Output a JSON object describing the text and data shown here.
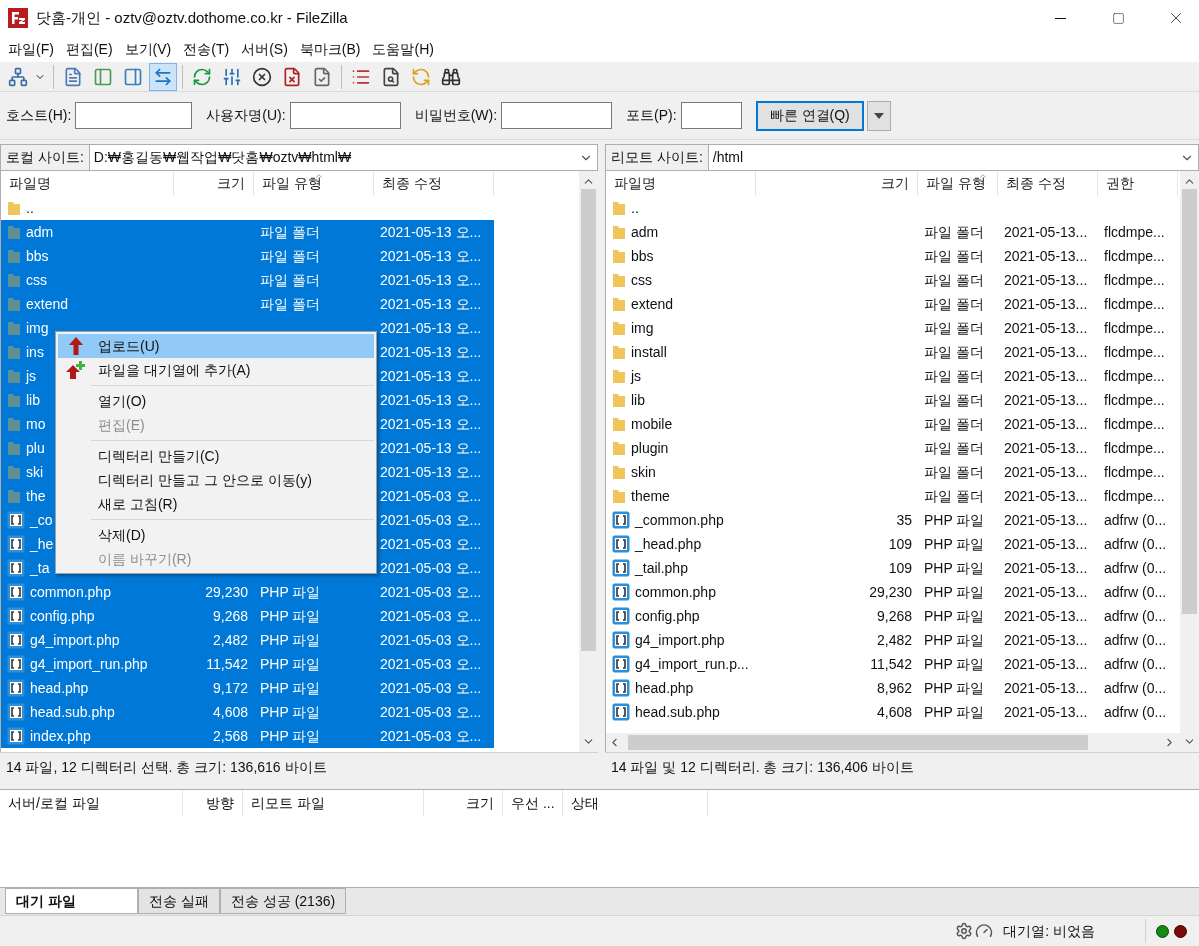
{
  "window": {
    "title": "닷홈-개인 - oztv@oztv.dothome.co.kr - FileZilla"
  },
  "menu": [
    "파일(F)",
    "편집(E)",
    "보기(V)",
    "전송(T)",
    "서버(S)",
    "북마크(B)",
    "도움말(H)"
  ],
  "toolbar": [
    {
      "on": false
    },
    {
      "on": false
    },
    {
      "on": false
    },
    {
      "on": false
    },
    {
      "on": true
    },
    {
      "on": false
    },
    {
      "on": false
    },
    {
      "on": false
    },
    {
      "on": false
    },
    {
      "on": false
    },
    {
      "on": false
    },
    {
      "on": false
    },
    {
      "on": false
    },
    {
      "on": false
    }
  ],
  "quickconnect": {
    "fields": [
      {
        "label": "호스트(H):"
      },
      {
        "label": "사용자명(U):"
      },
      {
        "label": "비밀번호(W):"
      },
      {
        "label": "포트(P):"
      }
    ],
    "button": "빠른 연결(Q)"
  },
  "local": {
    "site_label": "로컬 사이트:",
    "path": "D:₩홍길동₩웹작업₩닷홈₩oztv₩html₩",
    "columns": [
      {
        "label": "파일명",
        "sorted": false
      },
      {
        "label": "크기",
        "sorted": false
      },
      {
        "label": "파일 유형",
        "sorted": true
      },
      {
        "label": "최종 수정",
        "sorted": false
      }
    ],
    "rows": [
      {
        "kind": "parent",
        "name": "..",
        "selected": false
      },
      {
        "kind": "folder",
        "name": "adm",
        "type": "파일 폴더",
        "modified": "2021-05-13 오...",
        "selected": true
      },
      {
        "kind": "folder",
        "name": "bbs",
        "type": "파일 폴더",
        "modified": "2021-05-13 오...",
        "selected": true
      },
      {
        "kind": "folder",
        "name": "css",
        "type": "파일 폴더",
        "modified": "2021-05-13 오...",
        "selected": true
      },
      {
        "kind": "folder",
        "name": "extend",
        "type": "파일 폴더",
        "modified": "2021-05-13 오...",
        "selected": true
      },
      {
        "kind": "folder",
        "name": "img",
        "modified": "2021-05-13 오...",
        "selected": true
      },
      {
        "kind": "folder",
        "name": "ins",
        "modified": "2021-05-13 오...",
        "selected": true
      },
      {
        "kind": "folder",
        "name": "js",
        "modified": "2021-05-13 오...",
        "selected": true
      },
      {
        "kind": "folder",
        "name": "lib",
        "modified": "2021-05-13 오...",
        "selected": true
      },
      {
        "kind": "folder",
        "name": "mo",
        "modified": "2021-05-13 오...",
        "selected": true
      },
      {
        "kind": "folder",
        "name": "plu",
        "modified": "2021-05-13 오...",
        "selected": true
      },
      {
        "kind": "folder",
        "name": "ski",
        "modified": "2021-05-13 오...",
        "selected": true
      },
      {
        "kind": "folder",
        "name": "the",
        "modified": "2021-05-03 오...",
        "selected": true
      },
      {
        "kind": "file",
        "name": "_co",
        "modified": "2021-05-03 오...",
        "selected": true
      },
      {
        "kind": "file",
        "name": "_he",
        "modified": "2021-05-03 오...",
        "selected": true
      },
      {
        "kind": "file",
        "name": "_ta",
        "modified": "2021-05-03 오...",
        "selected": true
      },
      {
        "kind": "file",
        "name": "common.php",
        "size": "29,230",
        "type": "PHP 파일",
        "modified": "2021-05-03 오...",
        "selected": true
      },
      {
        "kind": "file",
        "name": "config.php",
        "size": "9,268",
        "type": "PHP 파일",
        "modified": "2021-05-03 오...",
        "selected": true
      },
      {
        "kind": "file",
        "name": "g4_import.php",
        "size": "2,482",
        "type": "PHP 파일",
        "modified": "2021-05-03 오...",
        "selected": true
      },
      {
        "kind": "file",
        "name": "g4_import_run.php",
        "size": "11,542",
        "type": "PHP 파일",
        "modified": "2021-05-03 오...",
        "selected": true
      },
      {
        "kind": "file",
        "name": "head.php",
        "size": "9,172",
        "type": "PHP 파일",
        "modified": "2021-05-03 오...",
        "selected": true
      },
      {
        "kind": "file",
        "name": "head.sub.php",
        "size": "4,608",
        "type": "PHP 파일",
        "modified": "2021-05-03 오...",
        "selected": true
      },
      {
        "kind": "file",
        "name": "index.php",
        "size": "2,568",
        "type": "PHP 파일",
        "modified": "2021-05-03 오...",
        "selected": true
      }
    ],
    "status": "14 파일, 12 디렉터리 선택. 총 크기: 136,616 바이트"
  },
  "context_menu": [
    {
      "kind": "item",
      "label": "업로드(U)",
      "selected": true,
      "disabled": false
    },
    {
      "kind": "item",
      "label": "파일을 대기열에 추가(A)",
      "selected": false,
      "disabled": false
    },
    {
      "kind": "separator"
    },
    {
      "kind": "item",
      "label": "열기(O)",
      "selected": false,
      "disabled": false
    },
    {
      "kind": "item",
      "label": "편집(E)",
      "selected": false,
      "disabled": true
    },
    {
      "kind": "separator"
    },
    {
      "kind": "item",
      "label": "디렉터리 만들기(C)",
      "selected": false,
      "disabled": false
    },
    {
      "kind": "item",
      "label": "디렉터리 만들고 그 안으로 이동(y)",
      "selected": false,
      "disabled": false
    },
    {
      "kind": "item",
      "label": "새로 고침(R)",
      "selected": false,
      "disabled": false
    },
    {
      "kind": "separator"
    },
    {
      "kind": "item",
      "label": "삭제(D)",
      "selected": false,
      "disabled": false
    },
    {
      "kind": "item",
      "label": "이름 바꾸기(R)",
      "selected": false,
      "disabled": true
    }
  ],
  "remote": {
    "site_label": "리모트 사이트:",
    "path": "/html",
    "columns": [
      {
        "label": "파일명",
        "sorted": false
      },
      {
        "label": "크기",
        "sorted": false
      },
      {
        "label": "파일 유형",
        "sorted": true
      },
      {
        "label": "최종 수정",
        "sorted": false
      },
      {
        "label": "권한",
        "sorted": false
      }
    ],
    "rows": [
      {
        "kind": "parent",
        "name": "..",
        "selected": false
      },
      {
        "kind": "folder",
        "name": "adm",
        "type": "파일 폴더",
        "modified": "2021-05-13...",
        "permissions": "flcdmpe...",
        "selected": false
      },
      {
        "kind": "folder",
        "name": "bbs",
        "type": "파일 폴더",
        "modified": "2021-05-13...",
        "permissions": "flcdmpe...",
        "selected": false
      },
      {
        "kind": "folder",
        "name": "css",
        "type": "파일 폴더",
        "modified": "2021-05-13...",
        "permissions": "flcdmpe...",
        "selected": false
      },
      {
        "kind": "folder",
        "name": "extend",
        "type": "파일 폴더",
        "modified": "2021-05-13...",
        "permissions": "flcdmpe...",
        "selected": false
      },
      {
        "kind": "folder",
        "name": "img",
        "type": "파일 폴더",
        "modified": "2021-05-13...",
        "permissions": "flcdmpe...",
        "selected": false
      },
      {
        "kind": "folder",
        "name": "install",
        "type": "파일 폴더",
        "modified": "2021-05-13...",
        "permissions": "flcdmpe...",
        "selected": false
      },
      {
        "kind": "folder",
        "name": "js",
        "type": "파일 폴더",
        "modified": "2021-05-13...",
        "permissions": "flcdmpe...",
        "selected": false
      },
      {
        "kind": "folder",
        "name": "lib",
        "type": "파일 폴더",
        "modified": "2021-05-13...",
        "permissions": "flcdmpe...",
        "selected": false
      },
      {
        "kind": "folder",
        "name": "mobile",
        "type": "파일 폴더",
        "modified": "2021-05-13...",
        "permissions": "flcdmpe...",
        "selected": false
      },
      {
        "kind": "folder",
        "name": "plugin",
        "type": "파일 폴더",
        "modified": "2021-05-13...",
        "permissions": "flcdmpe...",
        "selected": false
      },
      {
        "kind": "folder",
        "name": "skin",
        "type": "파일 폴더",
        "modified": "2021-05-13...",
        "permissions": "flcdmpe...",
        "selected": false
      },
      {
        "kind": "folder",
        "name": "theme",
        "type": "파일 폴더",
        "modified": "2021-05-13...",
        "permissions": "flcdmpe...",
        "selected": false
      },
      {
        "kind": "file",
        "name": "_common.php",
        "size": "35",
        "type": "PHP 파일",
        "modified": "2021-05-13...",
        "permissions": "adfrw (0...",
        "selected": false
      },
      {
        "kind": "file",
        "name": "_head.php",
        "size": "109",
        "type": "PHP 파일",
        "modified": "2021-05-13...",
        "permissions": "adfrw (0...",
        "selected": false
      },
      {
        "kind": "file",
        "name": "_tail.php",
        "size": "109",
        "type": "PHP 파일",
        "modified": "2021-05-13...",
        "permissions": "adfrw (0...",
        "selected": false
      },
      {
        "kind": "file",
        "name": "common.php",
        "size": "29,230",
        "type": "PHP 파일",
        "modified": "2021-05-13...",
        "permissions": "adfrw (0...",
        "selected": false
      },
      {
        "kind": "file",
        "name": "config.php",
        "size": "9,268",
        "type": "PHP 파일",
        "modified": "2021-05-13...",
        "permissions": "adfrw (0...",
        "selected": false
      },
      {
        "kind": "file",
        "name": "g4_import.php",
        "size": "2,482",
        "type": "PHP 파일",
        "modified": "2021-05-13...",
        "permissions": "adfrw (0...",
        "selected": false
      },
      {
        "kind": "file",
        "name": "g4_import_run.p...",
        "size": "11,542",
        "type": "PHP 파일",
        "modified": "2021-05-13...",
        "permissions": "adfrw (0...",
        "selected": false
      },
      {
        "kind": "file",
        "name": "head.php",
        "size": "8,962",
        "type": "PHP 파일",
        "modified": "2021-05-13...",
        "permissions": "adfrw (0...",
        "selected": false
      },
      {
        "kind": "file",
        "name": "head.sub.php",
        "size": "4,608",
        "type": "PHP 파일",
        "modified": "2021-05-13...",
        "permissions": "adfrw (0...",
        "selected": false
      }
    ],
    "status": "14 파일 및 12 디렉터리. 총 크기: 136,406 바이트"
  },
  "queue": {
    "columns": [
      "서버/로컬 파일",
      "방향",
      "리모트 파일",
      "크기",
      "우선 ...",
      "상태"
    ],
    "tabs": [
      {
        "label": "대기 파일",
        "selected": true
      },
      {
        "label": "전송 실패",
        "selected": false
      },
      {
        "label": "전송 성공 (2136)",
        "selected": false
      }
    ]
  },
  "status_bar": {
    "queue_text": "대기열: 비었음"
  }
}
